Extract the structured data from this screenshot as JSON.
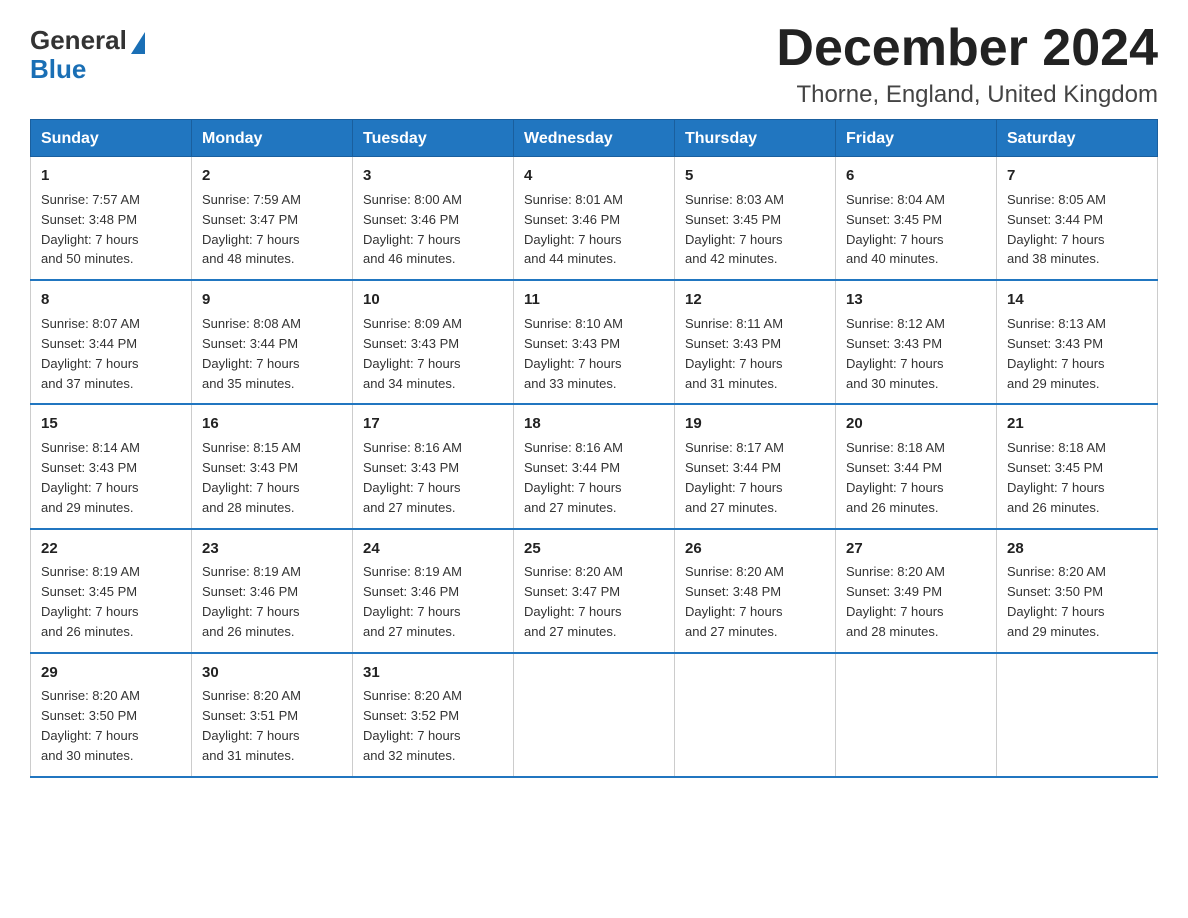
{
  "logo": {
    "general": "General",
    "blue": "Blue"
  },
  "title": "December 2024",
  "subtitle": "Thorne, England, United Kingdom",
  "days_header": [
    "Sunday",
    "Monday",
    "Tuesday",
    "Wednesday",
    "Thursday",
    "Friday",
    "Saturday"
  ],
  "weeks": [
    [
      {
        "day": "1",
        "info": "Sunrise: 7:57 AM\nSunset: 3:48 PM\nDaylight: 7 hours\nand 50 minutes."
      },
      {
        "day": "2",
        "info": "Sunrise: 7:59 AM\nSunset: 3:47 PM\nDaylight: 7 hours\nand 48 minutes."
      },
      {
        "day": "3",
        "info": "Sunrise: 8:00 AM\nSunset: 3:46 PM\nDaylight: 7 hours\nand 46 minutes."
      },
      {
        "day": "4",
        "info": "Sunrise: 8:01 AM\nSunset: 3:46 PM\nDaylight: 7 hours\nand 44 minutes."
      },
      {
        "day": "5",
        "info": "Sunrise: 8:03 AM\nSunset: 3:45 PM\nDaylight: 7 hours\nand 42 minutes."
      },
      {
        "day": "6",
        "info": "Sunrise: 8:04 AM\nSunset: 3:45 PM\nDaylight: 7 hours\nand 40 minutes."
      },
      {
        "day": "7",
        "info": "Sunrise: 8:05 AM\nSunset: 3:44 PM\nDaylight: 7 hours\nand 38 minutes."
      }
    ],
    [
      {
        "day": "8",
        "info": "Sunrise: 8:07 AM\nSunset: 3:44 PM\nDaylight: 7 hours\nand 37 minutes."
      },
      {
        "day": "9",
        "info": "Sunrise: 8:08 AM\nSunset: 3:44 PM\nDaylight: 7 hours\nand 35 minutes."
      },
      {
        "day": "10",
        "info": "Sunrise: 8:09 AM\nSunset: 3:43 PM\nDaylight: 7 hours\nand 34 minutes."
      },
      {
        "day": "11",
        "info": "Sunrise: 8:10 AM\nSunset: 3:43 PM\nDaylight: 7 hours\nand 33 minutes."
      },
      {
        "day": "12",
        "info": "Sunrise: 8:11 AM\nSunset: 3:43 PM\nDaylight: 7 hours\nand 31 minutes."
      },
      {
        "day": "13",
        "info": "Sunrise: 8:12 AM\nSunset: 3:43 PM\nDaylight: 7 hours\nand 30 minutes."
      },
      {
        "day": "14",
        "info": "Sunrise: 8:13 AM\nSunset: 3:43 PM\nDaylight: 7 hours\nand 29 minutes."
      }
    ],
    [
      {
        "day": "15",
        "info": "Sunrise: 8:14 AM\nSunset: 3:43 PM\nDaylight: 7 hours\nand 29 minutes."
      },
      {
        "day": "16",
        "info": "Sunrise: 8:15 AM\nSunset: 3:43 PM\nDaylight: 7 hours\nand 28 minutes."
      },
      {
        "day": "17",
        "info": "Sunrise: 8:16 AM\nSunset: 3:43 PM\nDaylight: 7 hours\nand 27 minutes."
      },
      {
        "day": "18",
        "info": "Sunrise: 8:16 AM\nSunset: 3:44 PM\nDaylight: 7 hours\nand 27 minutes."
      },
      {
        "day": "19",
        "info": "Sunrise: 8:17 AM\nSunset: 3:44 PM\nDaylight: 7 hours\nand 27 minutes."
      },
      {
        "day": "20",
        "info": "Sunrise: 8:18 AM\nSunset: 3:44 PM\nDaylight: 7 hours\nand 26 minutes."
      },
      {
        "day": "21",
        "info": "Sunrise: 8:18 AM\nSunset: 3:45 PM\nDaylight: 7 hours\nand 26 minutes."
      }
    ],
    [
      {
        "day": "22",
        "info": "Sunrise: 8:19 AM\nSunset: 3:45 PM\nDaylight: 7 hours\nand 26 minutes."
      },
      {
        "day": "23",
        "info": "Sunrise: 8:19 AM\nSunset: 3:46 PM\nDaylight: 7 hours\nand 26 minutes."
      },
      {
        "day": "24",
        "info": "Sunrise: 8:19 AM\nSunset: 3:46 PM\nDaylight: 7 hours\nand 27 minutes."
      },
      {
        "day": "25",
        "info": "Sunrise: 8:20 AM\nSunset: 3:47 PM\nDaylight: 7 hours\nand 27 minutes."
      },
      {
        "day": "26",
        "info": "Sunrise: 8:20 AM\nSunset: 3:48 PM\nDaylight: 7 hours\nand 27 minutes."
      },
      {
        "day": "27",
        "info": "Sunrise: 8:20 AM\nSunset: 3:49 PM\nDaylight: 7 hours\nand 28 minutes."
      },
      {
        "day": "28",
        "info": "Sunrise: 8:20 AM\nSunset: 3:50 PM\nDaylight: 7 hours\nand 29 minutes."
      }
    ],
    [
      {
        "day": "29",
        "info": "Sunrise: 8:20 AM\nSunset: 3:50 PM\nDaylight: 7 hours\nand 30 minutes."
      },
      {
        "day": "30",
        "info": "Sunrise: 8:20 AM\nSunset: 3:51 PM\nDaylight: 7 hours\nand 31 minutes."
      },
      {
        "day": "31",
        "info": "Sunrise: 8:20 AM\nSunset: 3:52 PM\nDaylight: 7 hours\nand 32 minutes."
      },
      {
        "day": "",
        "info": ""
      },
      {
        "day": "",
        "info": ""
      },
      {
        "day": "",
        "info": ""
      },
      {
        "day": "",
        "info": ""
      }
    ]
  ]
}
